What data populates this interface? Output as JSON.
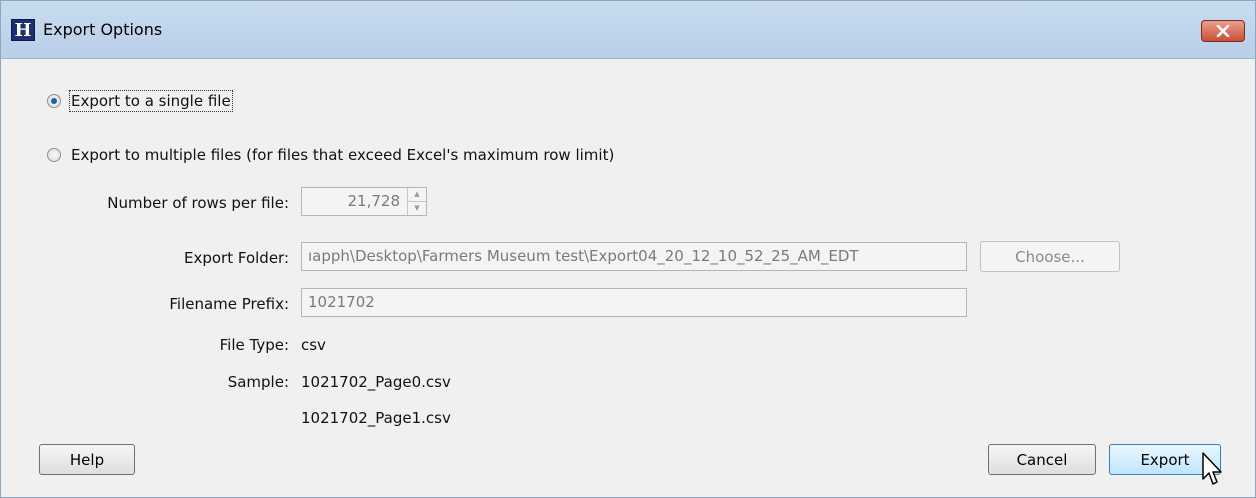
{
  "window": {
    "title": "Export Options"
  },
  "options": {
    "single_label": "Export to a single file",
    "multiple_label": "Export to multiple files (for files that exceed Excel's maximum row limit)",
    "selected": "single"
  },
  "form": {
    "rows_label": "Number of rows per file:",
    "rows_value": "21,728",
    "folder_label": "Export Folder:",
    "folder_value": "ıapph\\Desktop\\Farmers Museum test\\Export04_20_12_10_52_25_AM_EDT",
    "choose_label": "Choose...",
    "prefix_label": "Filename Prefix:",
    "prefix_value": "1021702",
    "filetype_label": "File Type:",
    "filetype_value": "csv",
    "sample_label": "Sample:",
    "sample_values": [
      "1021702_Page0.csv",
      "1021702_Page1.csv"
    ]
  },
  "buttons": {
    "help": "Help",
    "cancel": "Cancel",
    "export": "Export"
  },
  "colors": {
    "accent": "#1f5fa8",
    "close": "#c75037",
    "titlebar": "#c9dcef"
  },
  "icons": {
    "app": "app-h-icon",
    "close": "close-x-icon",
    "cursor": "mouse-pointer-icon"
  }
}
